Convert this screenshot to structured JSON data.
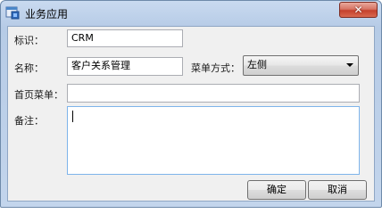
{
  "window": {
    "title": "业务应用",
    "close_glyph": "✕"
  },
  "form": {
    "id_label": "标识：",
    "id_value": "CRM",
    "name_label": "名称：",
    "name_value": "客户关系管理",
    "menu_mode_label": "菜单方式：",
    "menu_mode_value": "左侧",
    "home_menu_label": "首页菜单：",
    "home_menu_value": "",
    "note_label": "备注：",
    "note_value": ""
  },
  "buttons": {
    "ok_label": "确定",
    "cancel_label": "取消"
  },
  "icons": {
    "app": "app-window-icon",
    "close": "close-icon",
    "dropdown": "chevron-down-icon"
  }
}
